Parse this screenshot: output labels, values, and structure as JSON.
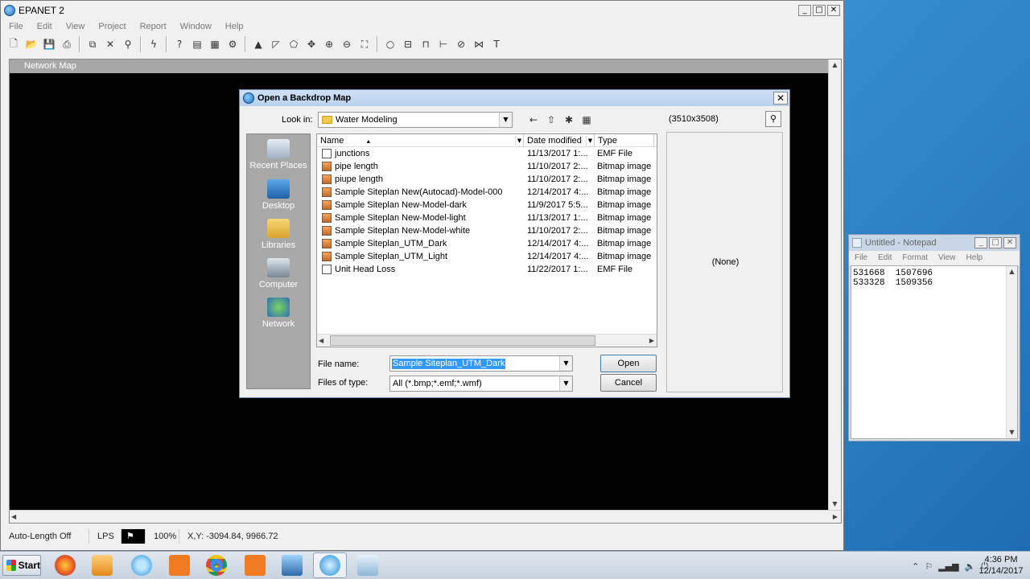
{
  "epanet": {
    "title": "EPANET 2",
    "menu": [
      "File",
      "Edit",
      "View",
      "Project",
      "Report",
      "Window",
      "Help"
    ],
    "child_title": "Network Map",
    "status": {
      "autolength": "Auto-Length Off",
      "units": "LPS",
      "zoom": "100%",
      "xy": "X,Y: -3094.84, 9966.72"
    }
  },
  "dialog": {
    "title": "Open a Backdrop Map",
    "look_in_label": "Look in:",
    "look_in_value": "Water Modeling",
    "places": [
      "Recent Places",
      "Desktop",
      "Libraries",
      "Computer",
      "Network"
    ],
    "columns": {
      "name": "Name",
      "date": "Date modified",
      "type": "Type"
    },
    "files": [
      {
        "name": "junctions",
        "date": "11/13/2017 1:...",
        "type": "EMF File",
        "kind": "emf"
      },
      {
        "name": "pipe length",
        "date": "11/10/2017 2:...",
        "type": "Bitmap image",
        "kind": "bmp"
      },
      {
        "name": "piupe length",
        "date": "11/10/2017 2:...",
        "type": "Bitmap image",
        "kind": "bmp"
      },
      {
        "name": "Sample Siteplan New(Autocad)-Model-000",
        "date": "12/14/2017 4:...",
        "type": "Bitmap image",
        "kind": "bmp"
      },
      {
        "name": "Sample Siteplan New-Model-dark",
        "date": "11/9/2017 5:5...",
        "type": "Bitmap image",
        "kind": "bmp"
      },
      {
        "name": "Sample Siteplan New-Model-light",
        "date": "11/13/2017 1:...",
        "type": "Bitmap image",
        "kind": "bmp"
      },
      {
        "name": "Sample Siteplan New-Model-white",
        "date": "11/10/2017 2:...",
        "type": "Bitmap image",
        "kind": "bmp"
      },
      {
        "name": "Sample Siteplan_UTM_Dark",
        "date": "12/14/2017 4:...",
        "type": "Bitmap image",
        "kind": "bmp"
      },
      {
        "name": "Sample Siteplan_UTM_Light",
        "date": "12/14/2017 4:...",
        "type": "Bitmap image",
        "kind": "bmp"
      },
      {
        "name": "Unit Head Loss",
        "date": "11/22/2017 1:...",
        "type": "EMF File",
        "kind": "emf"
      }
    ],
    "file_name_label": "File name:",
    "file_name_value": "Sample Siteplan_UTM_Dark",
    "file_type_label": "Files of type:",
    "file_type_value": "All (*.bmp;*.emf;*.wmf)",
    "open_label": "Open",
    "cancel_label": "Cancel",
    "preview_size": "(3510x3508)",
    "preview_none": "(None)"
  },
  "notepad": {
    "title": "Untitled - Notepad",
    "menu": [
      "File",
      "Edit",
      "Format",
      "View",
      "Help"
    ],
    "lines": [
      "531668  1507696",
      "533328  1509356"
    ]
  },
  "taskbar": {
    "start_label": "Start",
    "time": "4:36 PM",
    "date": "12/14/2017"
  }
}
